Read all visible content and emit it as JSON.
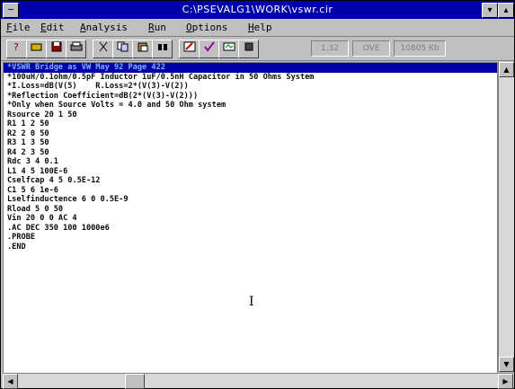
{
  "window": {
    "title": "C:\\PSEVALG1\\WORK\\vswr.cir",
    "sysmenu_glyph": "─",
    "minimize_glyph": "▾",
    "maximize_glyph": "▴"
  },
  "menu": [
    "File",
    "Edit",
    "Analysis",
    "Run",
    "Options",
    "Help"
  ],
  "toolbar": {
    "tools": [
      "help-icon",
      "open-icon",
      "save-icon",
      "print-icon",
      "cut-icon",
      "copy-icon",
      "paste-icon",
      "find-icon",
      "edit-icon",
      "check-icon",
      "simulate-icon",
      "stop-icon"
    ],
    "line_indicator": "1,32",
    "mode_indicator": "OVE",
    "memory_indicator": "10805 Kb"
  },
  "editor": {
    "lines": [
      "*VSWR Bridge as VW May 92 Page 422",
      "*100uH/0.1ohm/0.5pF Inductor 1uF/0.5nH Capacitor in 50 Ohms System",
      "*I.Loss=dB(V(5)    R.Loss=2*(V(3)-V(2))",
      "*Reflection Coefficient=dB(2*(V(3)-V(2)))",
      "*Only when Source Volts = 4.0 and 50 Ohm system",
      "Rsource 20 1 50",
      "R1 1 2 50",
      "R2 2 0 50",
      "R3 1 3 50",
      "R4 2 3 50",
      "Rdc 3 4 0.1",
      "L1 4 5 100E-6",
      "Cselfcap 4 5 0.5E-12",
      "C1 5 6 1e-6",
      "Lselfinductence 6 0 0.5E-9",
      "Rload 5 0 50",
      "Vin 20 0 0 AC 4",
      ".AC DEC 350 100 1000e6",
      ".PROBE",
      ".END"
    ],
    "caret_glyph": "I"
  },
  "scrollbars": {
    "up": "▲",
    "down": "▼",
    "left": "◀",
    "right": "▶"
  }
}
